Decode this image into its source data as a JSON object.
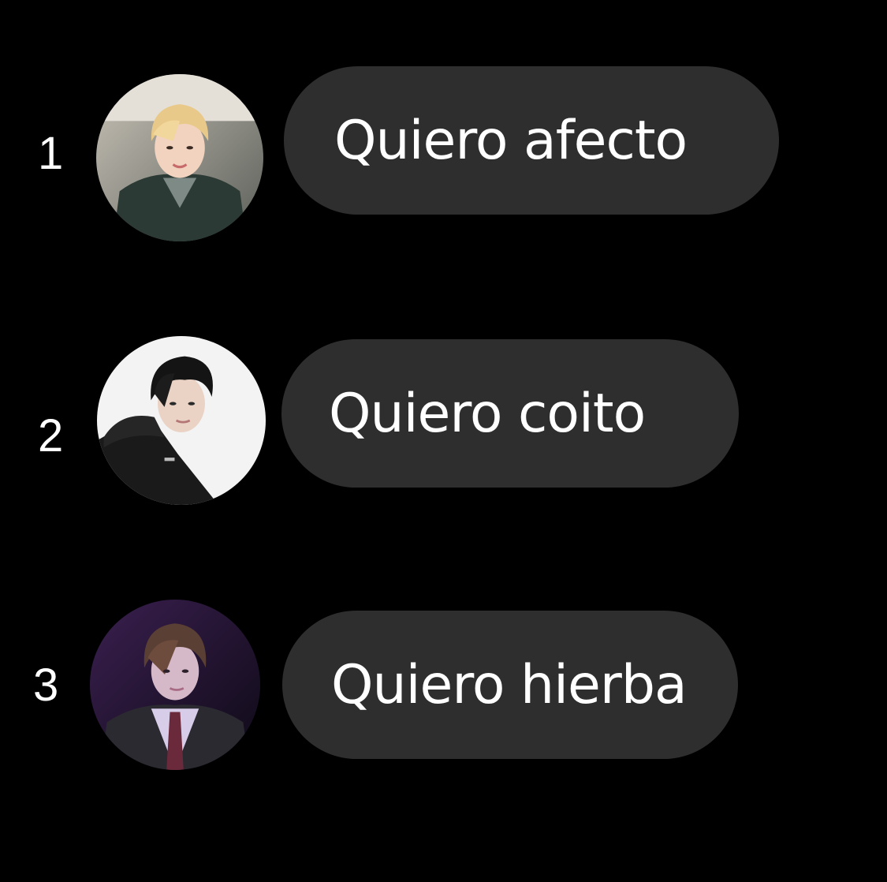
{
  "suggestions": [
    {
      "number": "1",
      "text": "Quiero afecto",
      "avatar": "avatar-photo-blond-hair"
    },
    {
      "number": "2",
      "text": "Quiero coito",
      "avatar": "avatar-photo-black-hair"
    },
    {
      "number": "3",
      "text": "Quiero hierba",
      "avatar": "avatar-photo-purple-light"
    }
  ],
  "colors": {
    "background": "#000000",
    "bubble": "#2e2e2e",
    "text": "#ffffff"
  }
}
